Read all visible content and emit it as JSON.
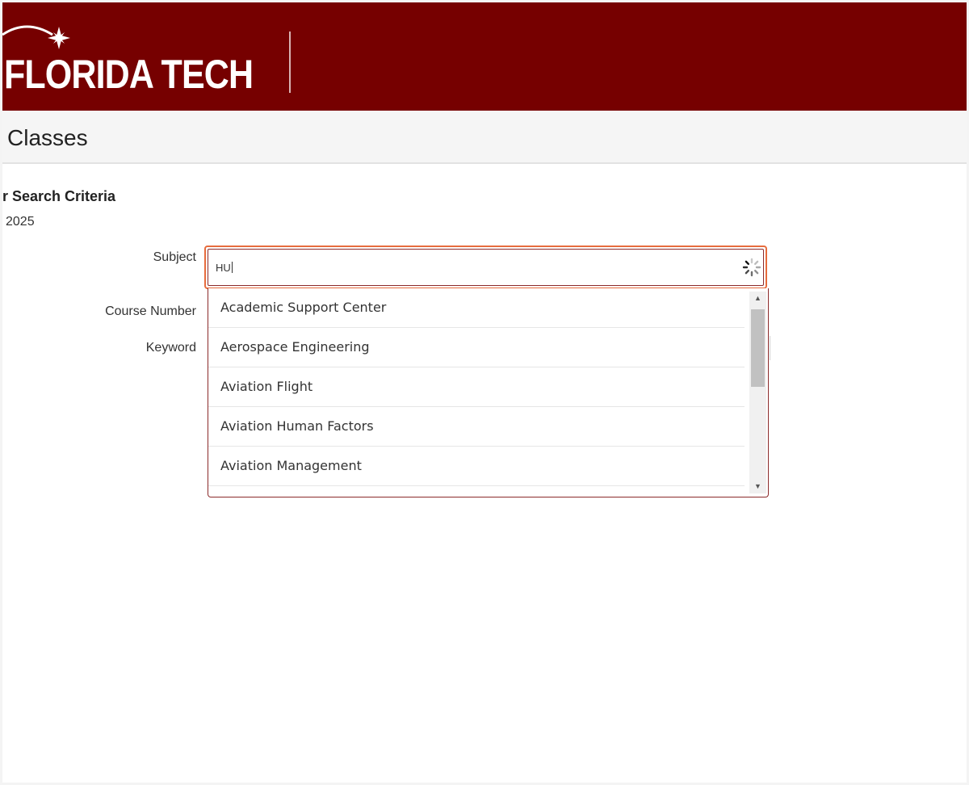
{
  "brand": {
    "name": "FLORIDA TECH",
    "header_color": "#760000",
    "accent_focus": "#e76c3d"
  },
  "page": {
    "title": "Classes"
  },
  "search": {
    "section_title": "r Search Criteria",
    "term": "2025",
    "subject_label": "Subject",
    "subject_value": "HU",
    "course_number_label": "Course Number",
    "keyword_label": "Keyword"
  },
  "dropdown": {
    "options": [
      "Academic Support Center",
      "Aerospace Engineering",
      "Aviation Flight",
      "Aviation Human Factors",
      "Aviation Management"
    ]
  },
  "icons": {
    "loading": "spinner-icon",
    "scroll_up": "scroll-up-arrow-icon",
    "scroll_down": "scroll-down-arrow-icon",
    "logo_star": "star-icon"
  }
}
